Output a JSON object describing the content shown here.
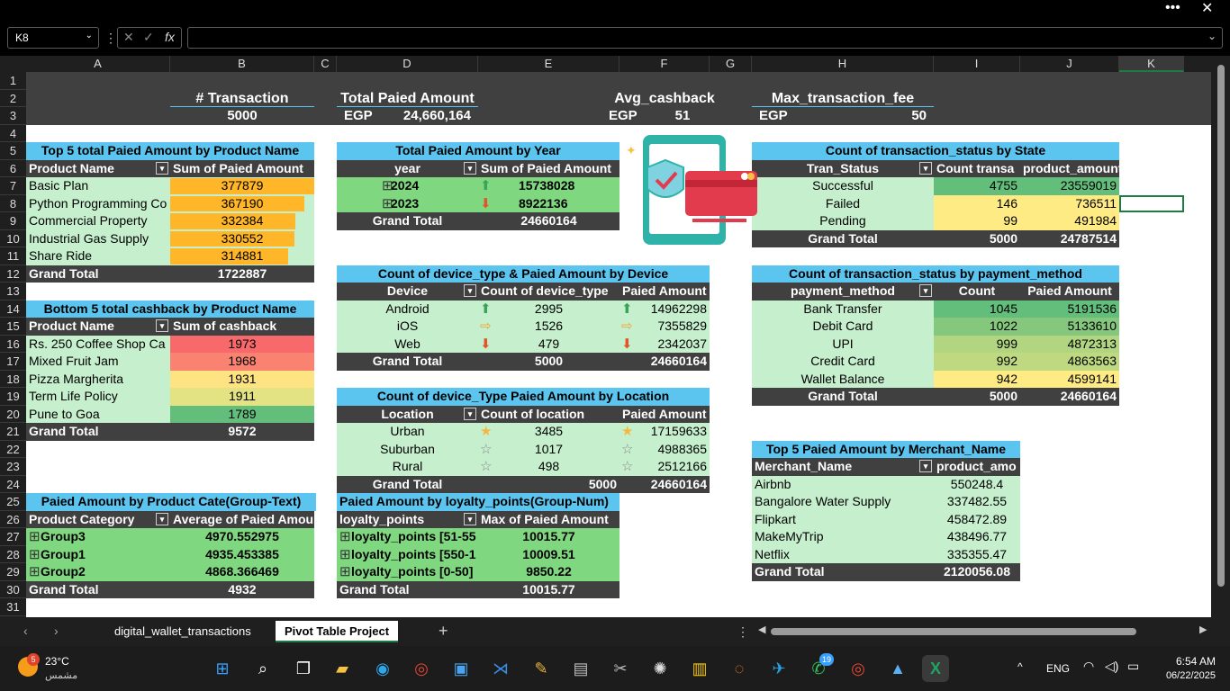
{
  "window": {
    "menu_icon": "more-horizontal-icon",
    "close_icon": "close-icon"
  },
  "formula_bar": {
    "name_box": "K8",
    "formula": ""
  },
  "columns": [
    "A",
    "B",
    "C",
    "D",
    "E",
    "F",
    "G",
    "H",
    "I",
    "J",
    "K"
  ],
  "rows": [
    "1",
    "2",
    "3",
    "4",
    "5",
    "6",
    "7",
    "8",
    "9",
    "10",
    "11",
    "12",
    "13",
    "14",
    "15",
    "16",
    "17",
    "18",
    "19",
    "20",
    "21",
    "22",
    "23",
    "24",
    "25",
    "26",
    "27",
    "28",
    "29",
    "30",
    "31"
  ],
  "kpis": {
    "transaction": {
      "label": "# Transaction",
      "value": "5000"
    },
    "total_paid": {
      "label": "Total Paied Amount",
      "currency": "EGP",
      "value": "24,660,164"
    },
    "avg_cashback": {
      "label": "Avg_cashback",
      "currency": "EGP",
      "value": "51"
    },
    "max_fee": {
      "label": "Max_transaction_fee",
      "currency": "EGP",
      "value": "50"
    }
  },
  "top5": {
    "title": "Top 5 total Paied Amount by Product Name",
    "headers": [
      "Product Name",
      "Sum of Paied Amount"
    ],
    "rows": [
      {
        "name": "Basic Plan",
        "value": "377879",
        "pct": 1.0
      },
      {
        "name": "Python Programming Co",
        "value": "367190",
        "pct": 0.93
      },
      {
        "name": "Commercial Property",
        "value": "332384",
        "pct": 0.87
      },
      {
        "name": "Industrial Gas Supply",
        "value": "330552",
        "pct": 0.86
      },
      {
        "name": "Share Ride",
        "value": "314881",
        "pct": 0.82
      }
    ],
    "total_label": "Grand Total",
    "total": "1722887"
  },
  "bottom5": {
    "title": "Bottom 5 total cashback by Product Name",
    "headers": [
      "Product Name",
      "Sum of cashback"
    ],
    "rows": [
      {
        "name": "Rs. 250 Coffee Shop Ca",
        "value": "1973",
        "color": "#f8696b"
      },
      {
        "name": "Mixed Fruit Jam",
        "value": "1968",
        "color": "#f98370"
      },
      {
        "name": "Pizza Margherita",
        "value": "1931",
        "color": "#fee382"
      },
      {
        "name": "Term Life Policy",
        "value": "1911",
        "color": "#e3e383"
      },
      {
        "name": "Pune to Goa",
        "value": "1789",
        "color": "#63be7b"
      }
    ],
    "total_label": "Grand Total",
    "total": "9572"
  },
  "category": {
    "title": "Paied Amount  by Product Cate(Group-Text)",
    "headers": [
      "Product Category",
      "Average of Paied Amou"
    ],
    "rows": [
      {
        "name": "Group3",
        "value": "4970.552975"
      },
      {
        "name": "Group1",
        "value": "4935.453385"
      },
      {
        "name": "Group2",
        "value": "4868.366469"
      }
    ],
    "total_label": "Grand Total",
    "total": "4932"
  },
  "year": {
    "title": "Total Paied Amount by Year",
    "headers": [
      "year",
      "Sum of Paied Amount"
    ],
    "rows": [
      {
        "name": "2024",
        "value": "15738028",
        "arrow": "up"
      },
      {
        "name": "2023",
        "value": "8922136",
        "arrow": "down"
      }
    ],
    "total_label": "Grand Total",
    "total": "24660164"
  },
  "device": {
    "title": "Count of device_type & Paied Amount by Device",
    "headers": [
      "Device",
      "Count of device_type",
      "Paied Amount"
    ],
    "rows": [
      {
        "name": "Android",
        "count": "2995",
        "amount": "14962298",
        "icon": "up"
      },
      {
        "name": "iOS",
        "count": "1526",
        "amount": "7355829",
        "icon": "right"
      },
      {
        "name": "Web",
        "count": "479",
        "amount": "2342037",
        "icon": "down"
      }
    ],
    "total_label": "Grand Total",
    "total_count": "5000",
    "total_amount": "24660164"
  },
  "location": {
    "title": "Count of device_Type Paied Amount by Location",
    "headers": [
      "Location",
      "Count of location",
      "Paied Amount"
    ],
    "rows": [
      {
        "name": "Urban",
        "count": "3485",
        "amount": "17159633",
        "star": "full"
      },
      {
        "name": "Suburban",
        "count": "1017",
        "amount": "4988365",
        "star": "empty"
      },
      {
        "name": "Rural",
        "count": "498",
        "amount": "2512166",
        "star": "empty"
      }
    ],
    "total_label": "Grand Total",
    "total_count": "5000",
    "total_amount": "24660164"
  },
  "loyalty": {
    "title": "Paied Amount by loyalty_points(Group-Num)",
    "headers": [
      "loyalty_points",
      "Max of Paied Amount"
    ],
    "rows": [
      {
        "name": "loyalty_points [51-55",
        "value": "10015.77"
      },
      {
        "name": "loyalty_points [550-1",
        "value": "10009.51"
      },
      {
        "name": "loyalty_points [0-50]",
        "value": "9850.22"
      }
    ],
    "total_label": "Grand Total",
    "total": "10015.77"
  },
  "status": {
    "title": "Count of transaction_status by State",
    "headers": [
      "Tran_Status",
      "Count transa",
      "product_amount"
    ],
    "rows": [
      {
        "name": "Successful",
        "count": "4755",
        "amount": "23559019",
        "color": "#63be7b"
      },
      {
        "name": "Failed",
        "count": "146",
        "amount": "736511",
        "color": "#ffeb84"
      },
      {
        "name": "Pending",
        "count": "99",
        "amount": "491984",
        "color": "#ffeb84"
      }
    ],
    "total_label": "Grand Total",
    "total_count": "5000",
    "total_amount": "24787514"
  },
  "payment": {
    "title": "Count of transaction_status by payment_method",
    "headers": [
      "payment_method",
      "Count",
      "Paied Amount"
    ],
    "rows": [
      {
        "name": "Bank Transfer",
        "count": "1045",
        "amount": "5191536",
        "color": "#63be7b"
      },
      {
        "name": "Debit Card",
        "count": "1022",
        "amount": "5133610",
        "color": "#85c77d"
      },
      {
        "name": "UPI",
        "count": "999",
        "amount": "4872313",
        "color": "#b1d580"
      },
      {
        "name": "Credit Card",
        "count": "992",
        "amount": "4863563",
        "color": "#bfd981"
      },
      {
        "name": "Wallet Balance",
        "count": "942",
        "amount": "4599141",
        "color": "#ffeb84"
      }
    ],
    "total_label": "Grand Total",
    "total_count": "5000",
    "total_amount": "24660164"
  },
  "merchant": {
    "title": "Top 5 Paied Amount by Merchant_Name",
    "headers": [
      "Merchant_Name",
      "product_amo"
    ],
    "rows": [
      {
        "name": "Airbnb",
        "value": "550248.4"
      },
      {
        "name": "Bangalore Water Supply",
        "value": "337482.55"
      },
      {
        "name": "Flipkart",
        "value": "458472.89"
      },
      {
        "name": "MakeMyTrip",
        "value": "438496.77"
      },
      {
        "name": "Netflix",
        "value": "335355.47"
      }
    ],
    "total_label": "Grand Total",
    "total": "2120056.08"
  },
  "sheets": [
    "digital_wallet_transactions",
    "Pivot Table Project"
  ],
  "taskbar": {
    "weather_temp": "23°C",
    "weather_desc": "مشمس",
    "weather_badge": "5",
    "lang": "ENG",
    "time": "6:54 AM",
    "date": "06/22/2025",
    "whatsapp_badge": "19"
  }
}
